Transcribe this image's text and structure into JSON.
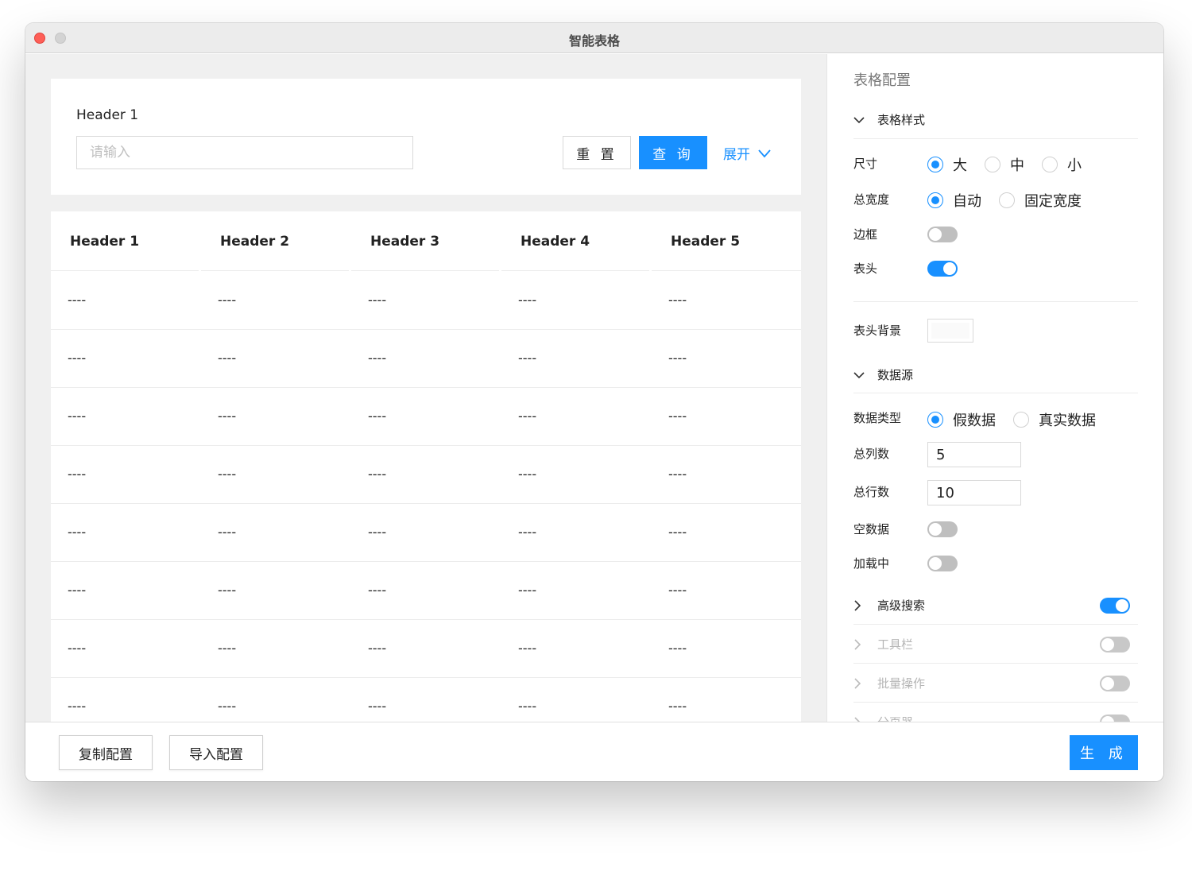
{
  "window": {
    "title": "智能表格"
  },
  "search": {
    "field_label": "Header 1",
    "placeholder": "请输入",
    "reset_label": "重 置",
    "query_label": "查 询",
    "expand_label": "展开"
  },
  "table": {
    "headers": [
      "Header 1",
      "Header 2",
      "Header 3",
      "Header 4",
      "Header 5"
    ],
    "rows": [
      [
        "----",
        "----",
        "----",
        "----",
        "----"
      ],
      [
        "----",
        "----",
        "----",
        "----",
        "----"
      ],
      [
        "----",
        "----",
        "----",
        "----",
        "----"
      ],
      [
        "----",
        "----",
        "----",
        "----",
        "----"
      ],
      [
        "----",
        "----",
        "----",
        "----",
        "----"
      ],
      [
        "----",
        "----",
        "----",
        "----",
        "----"
      ],
      [
        "----",
        "----",
        "----",
        "----",
        "----"
      ],
      [
        "----",
        "----",
        "----",
        "----",
        "----"
      ]
    ]
  },
  "panel": {
    "title": "表格配置",
    "style_section": {
      "title": "表格样式",
      "size": {
        "label": "尺寸",
        "options": [
          "大",
          "中",
          "小"
        ],
        "selected": "大"
      },
      "width": {
        "label": "总宽度",
        "options": [
          "自动",
          "固定宽度"
        ],
        "selected": "自动"
      },
      "border": {
        "label": "边框",
        "on": false
      },
      "header": {
        "label": "表头",
        "on": true
      },
      "header_bg": {
        "label": "表头背景",
        "color": "#fafafa"
      }
    },
    "data_section": {
      "title": "数据源",
      "data_type": {
        "label": "数据类型",
        "options": [
          "假数据",
          "真实数据"
        ],
        "selected": "假数据"
      },
      "columns": {
        "label": "总列数",
        "value": "5"
      },
      "rows": {
        "label": "总行数",
        "value": "10"
      },
      "empty": {
        "label": "空数据",
        "on": false
      },
      "loading": {
        "label": "加载中",
        "on": false
      }
    },
    "features": [
      {
        "label": "高级搜索",
        "on": true,
        "dim": false
      },
      {
        "label": "工具栏",
        "on": false,
        "dim": true
      },
      {
        "label": "批量操作",
        "on": false,
        "dim": true
      },
      {
        "label": "分页器",
        "on": false,
        "dim": true
      }
    ]
  },
  "footer": {
    "copy_label": "复制配置",
    "import_label": "导入配置",
    "generate_label": "生 成"
  },
  "colors": {
    "accent": "#1890ff",
    "close": "#fe5f57"
  }
}
